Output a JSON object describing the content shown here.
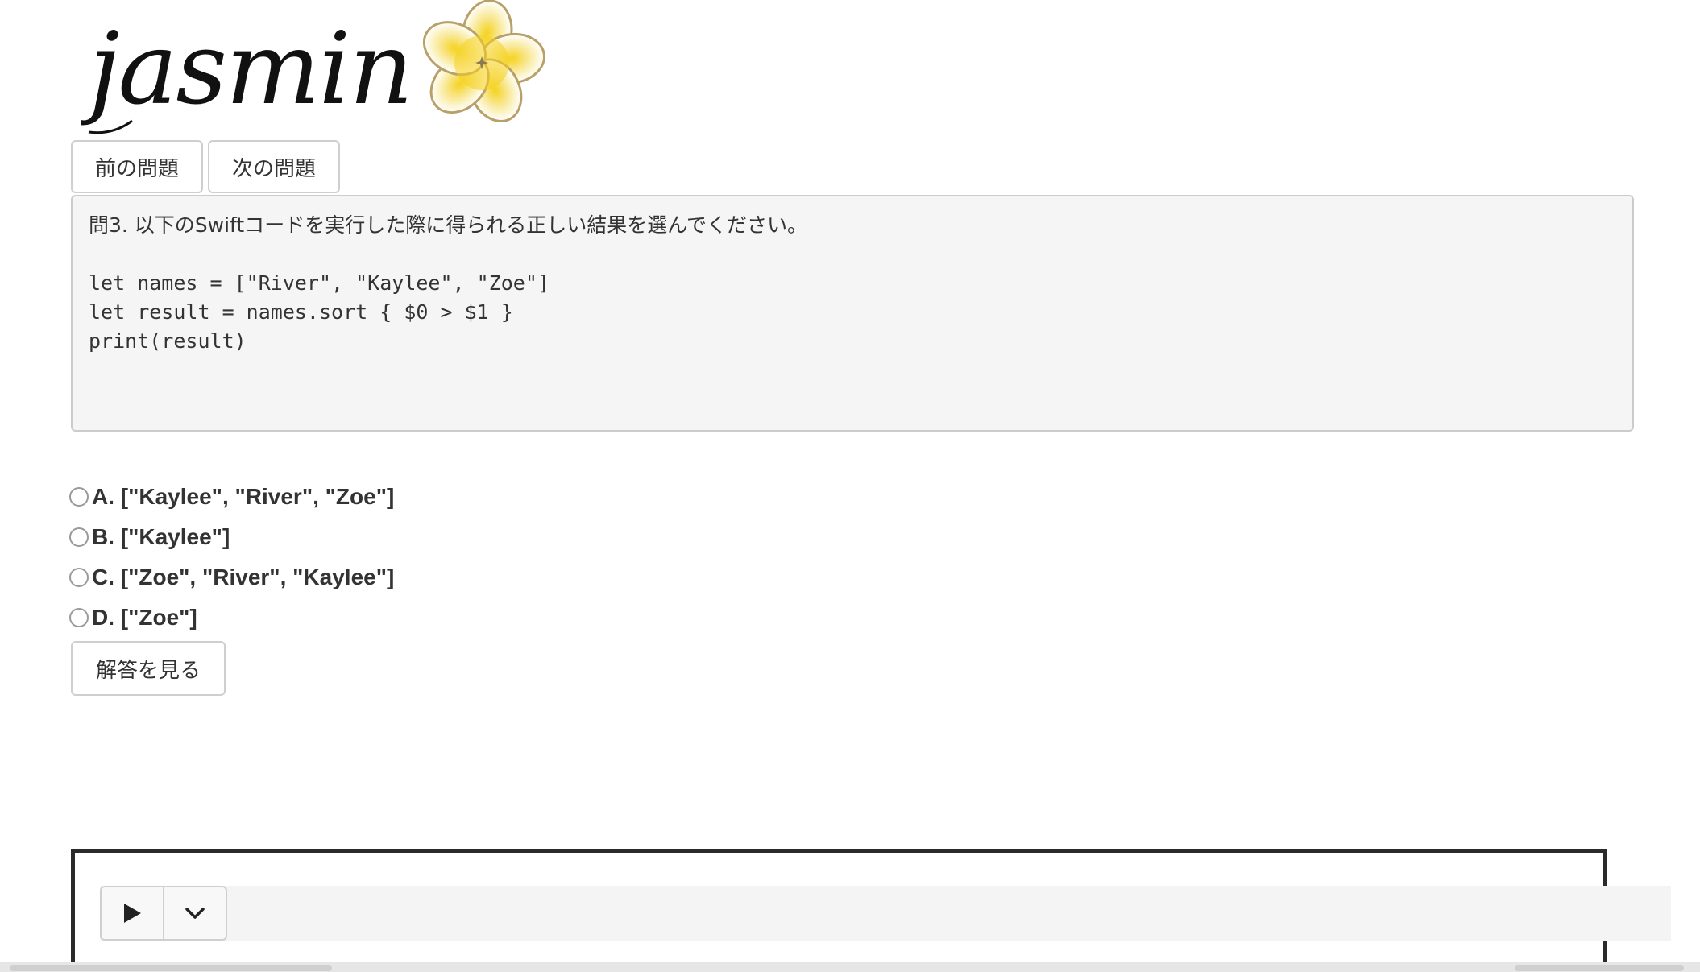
{
  "logo": {
    "text": "jasmin",
    "icon": "jasmine-flower-icon"
  },
  "nav": {
    "prev_label": "前の問題",
    "next_label": "次の問題"
  },
  "question": {
    "title": "問3. 以下のSwiftコードを実行した際に得られる正しい結果を選んでください。",
    "code": "let names = [\"River\", \"Kaylee\", \"Zoe\"]\nlet result = names.sort { $0 > $1 }\nprint(result)"
  },
  "options": [
    {
      "label": "A. [\"Kaylee\", \"River\", \"Zoe\"]"
    },
    {
      "label": "B. [\"Kaylee\"]"
    },
    {
      "label": "C. [\"Zoe\", \"River\", \"Kaylee\"]"
    },
    {
      "label": "D. [\"Zoe\"]"
    }
  ],
  "answer_button_label": "解答を見る",
  "player": {
    "play_icon": "play-icon",
    "menu_icon": "chevron-down-icon"
  },
  "colors": {
    "flower_yellow": "#f5d94a",
    "flower_outline": "#b8a06a",
    "panel_bg": "#f5f5f5"
  }
}
